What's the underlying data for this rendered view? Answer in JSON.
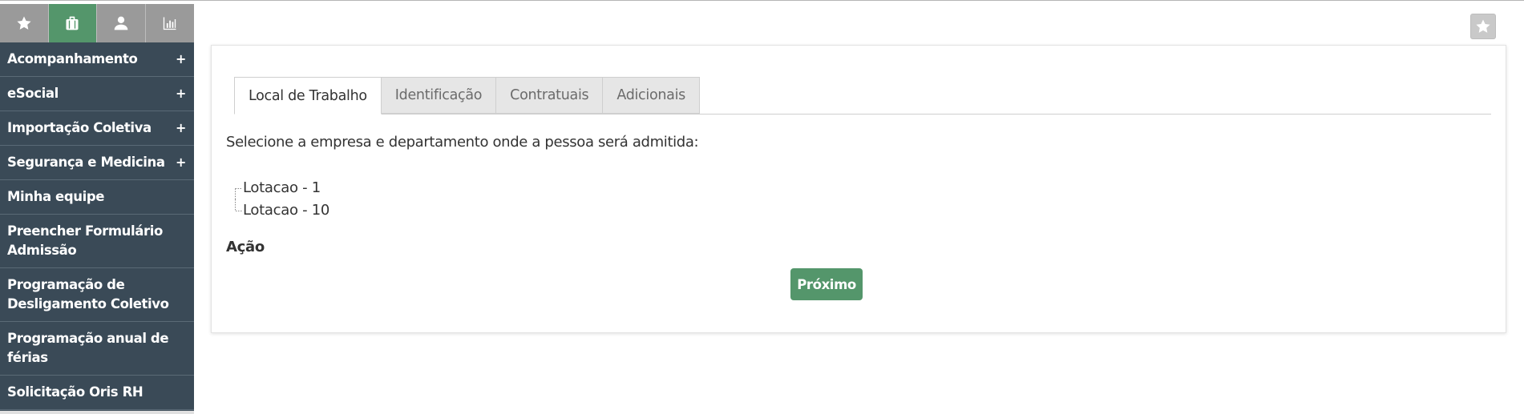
{
  "sidebar": {
    "tabs": [
      {
        "icon": "star-icon",
        "active": false
      },
      {
        "icon": "briefcase-icon",
        "active": true
      },
      {
        "icon": "user-icon",
        "active": false
      },
      {
        "icon": "bar-chart-icon",
        "active": false
      }
    ],
    "menu": [
      {
        "label": "Acompanhamento",
        "expandable": true,
        "plus": "+"
      },
      {
        "label": "eSocial",
        "expandable": true,
        "plus": "+"
      },
      {
        "label": "Importação Coletiva",
        "expandable": true,
        "plus": "+"
      },
      {
        "label": "Segurança e Medicina",
        "expandable": true,
        "plus": "+"
      },
      {
        "label": "Minha equipe",
        "expandable": false
      },
      {
        "label": "Preencher Formulário Admissão",
        "expandable": false
      },
      {
        "label": "Programação de Desligamento Coletivo",
        "expandable": false
      },
      {
        "label": "Programação anual de férias",
        "expandable": false
      },
      {
        "label": "Solicitação Oris RH",
        "expandable": false
      }
    ]
  },
  "main": {
    "favorite_icon": "star-icon",
    "tabs": [
      {
        "label": "Local de Trabalho",
        "active": true
      },
      {
        "label": "Identificação",
        "active": false
      },
      {
        "label": "Contratuais",
        "active": false
      },
      {
        "label": "Adicionais",
        "active": false
      }
    ],
    "instruction": "Selecione a empresa e departamento onde a pessoa será admitida:",
    "tree": [
      "Lotacao - 1",
      "Lotacao - 10"
    ],
    "action_label": "Ação",
    "next_button": "Próximo"
  },
  "colors": {
    "sidebar_bg": "#3a4a57",
    "accent_green": "#54966b",
    "tab_inactive": "#9a9a9a"
  }
}
